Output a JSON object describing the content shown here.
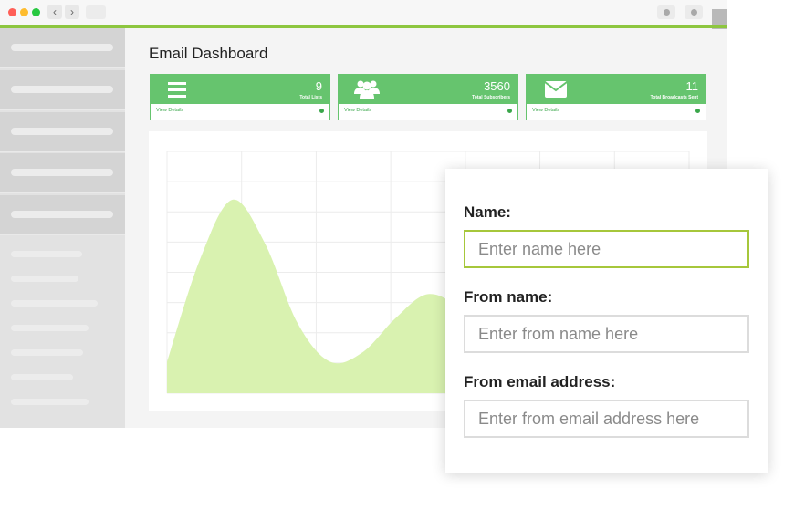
{
  "window": {
    "traffic_lights": [
      "#ff5f57",
      "#febc2e",
      "#28c840"
    ],
    "nav": {
      "back_icon": "‹",
      "forward_icon": "›"
    },
    "accent": "#8dc63f"
  },
  "dashboard": {
    "title": "Email Dashboard",
    "stats": [
      {
        "icon": "list-icon",
        "value": "9",
        "label": "Total Lists",
        "link": "View Details"
      },
      {
        "icon": "users-icon",
        "value": "3560",
        "label": "Total Subscribers",
        "link": "View Details"
      },
      {
        "icon": "envelope-icon",
        "value": "11",
        "label": "Total Broadcasts Sent",
        "link": "View Details"
      }
    ],
    "stat_color": "#66c46e"
  },
  "chart_data": {
    "type": "area",
    "x": [
      0,
      1,
      2,
      3,
      4,
      5,
      6,
      7,
      8,
      9,
      10,
      11,
      12,
      13,
      14,
      15,
      16
    ],
    "values": [
      13,
      55,
      80,
      62,
      29,
      13,
      17,
      31,
      41,
      34,
      14,
      6,
      12,
      24,
      36,
      30,
      20
    ],
    "ylim": [
      0,
      100
    ],
    "fill": "#d9f2b0",
    "grid": true,
    "title": "",
    "xlabel": "",
    "ylabel": ""
  },
  "form": {
    "name": {
      "label": "Name:",
      "placeholder": "Enter name here"
    },
    "from_name": {
      "label": "From name:",
      "placeholder": "Enter from name here"
    },
    "from_email": {
      "label": "From email address:",
      "placeholder": "Enter from email address here"
    }
  }
}
